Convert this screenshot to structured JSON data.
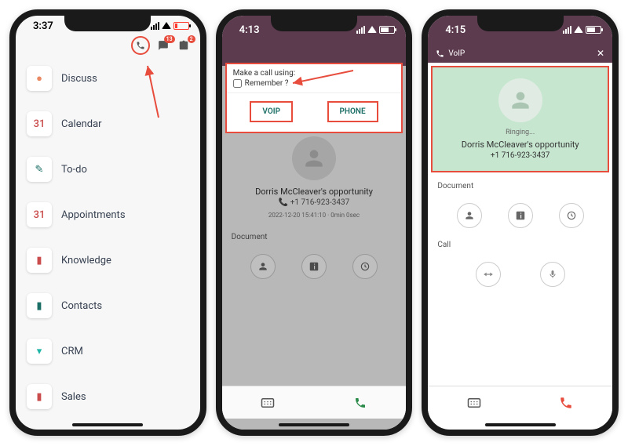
{
  "phone1": {
    "time": "3:37",
    "header": {
      "badge1": "13",
      "badge2": "2"
    },
    "menu": [
      {
        "icon_color": "#e98862",
        "label": "Discuss",
        "glyph": "●"
      },
      {
        "icon_color": "#c94b4b",
        "label": "Calendar",
        "glyph": "31"
      },
      {
        "icon_color": "#1a6e66",
        "label": "To-do",
        "glyph": "✎"
      },
      {
        "icon_color": "#c94b4b",
        "label": "Appointments",
        "glyph": "31"
      },
      {
        "icon_color": "#c94b4b",
        "label": "Knowledge",
        "glyph": "▮"
      },
      {
        "icon_color": "#1a6e66",
        "label": "Contacts",
        "glyph": "▮"
      },
      {
        "icon_color": "#1fb5a7",
        "label": "CRM",
        "glyph": "▾"
      },
      {
        "icon_color": "#c94b4b",
        "label": "Sales",
        "glyph": "▮"
      }
    ]
  },
  "phone2": {
    "time": "4:13",
    "dialog": {
      "prompt": "Make a call using:",
      "remember": "Remember ?",
      "voip": "VOIP",
      "phone": "PHONE"
    },
    "card": {
      "title": "Dorris McCleaver's opportunity",
      "number": "📞 +1 716-923-3437",
      "timestamp": "2022-12-20 15:41:10 · 0min 0sec"
    },
    "document_label": "Document"
  },
  "phone3": {
    "time": "4:15",
    "voip_label": "VoIP",
    "ringing": "Ringing...",
    "title": "Dorris McCleaver's opportunity",
    "number": "+1 716-923-3437",
    "document_label": "Document",
    "call_label": "Call"
  }
}
